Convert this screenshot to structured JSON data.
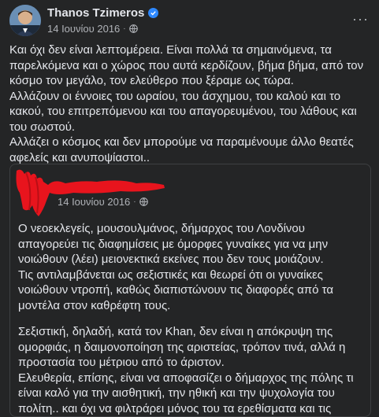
{
  "post": {
    "author": "Thanos Tzimeros",
    "date": "14 Ιουνίου 2016",
    "separator": "·",
    "more_label": "···",
    "paragraphs": [
      "Και όχι δεν είναι λεπτομέρεια. Είναι πολλά τα σημαινόμενα, τα παρελκόμενα και ο χώρος που αυτά κερδίζουν, βήμα βήμα, από τον κόσμο τον μεγάλο, τον ελεύθερο που ξέραμε ως τώρα.",
      "Αλλάζουν οι έννοιες του ωραίου, του άσχημου, του καλού και το κακού, του επιτρεπόμενου και του απαγορευμένου, του λάθους και του σωστού.",
      "Αλλάζει ο κόσμος και δεν μπορούμε να παραμένουμε άλλο θεατές αφελείς και ανυποψίαστοι.."
    ]
  },
  "shared": {
    "date": "14 Ιουνίου 2016",
    "separator": "·",
    "paragraphs_a": [
      "Ο νεοεκλεγείς, μουσουλμάνος, δήμαρχος του Λονδίνου απαγορεύει τις διαφημίσεις με όμορφες γυναίκες για να μην νοιώθουν (λέει) μειονεκτικά εκείνες που δεν τους μοιάζουν.",
      "Τις αντιλαμβάνεται ως σεξιστικές και θεωρεί ότι οι γυναίκες νοιώθουν ντροπή, καθώς διαπιστώνουν τις διαφορές από τα μοντέλα στον καθρέφτη τους."
    ],
    "paragraphs_b": [
      "Σεξιστική, δηλαδή, κατά τον Khan, δεν είναι η απόκρυψη της ομορφιάς, η δαιμονοποίηση της αριστείας, τρόπον τινά, αλλά η προστασία του μέτριου από το άριστον.",
      "Ελευθερία, επίσης, είναι να αποφασίζει ο δήμαρχος της πόλης τι είναι καλό για την αισθητική, την ηθική και την ψυχολογία του πολίτη.. και όχι να φιλτράρει μόνος του τα ερεθίσματα και τις"
    ]
  },
  "icons": {
    "verified": "verified-badge-icon",
    "audience": "globe-icon",
    "more": "more-options-icon"
  },
  "colors": {
    "background": "#242526",
    "text": "#e4e6eb",
    "secondary": "#b0b3b8",
    "verified": "#2d88ff",
    "redaction": "#e8141d"
  }
}
